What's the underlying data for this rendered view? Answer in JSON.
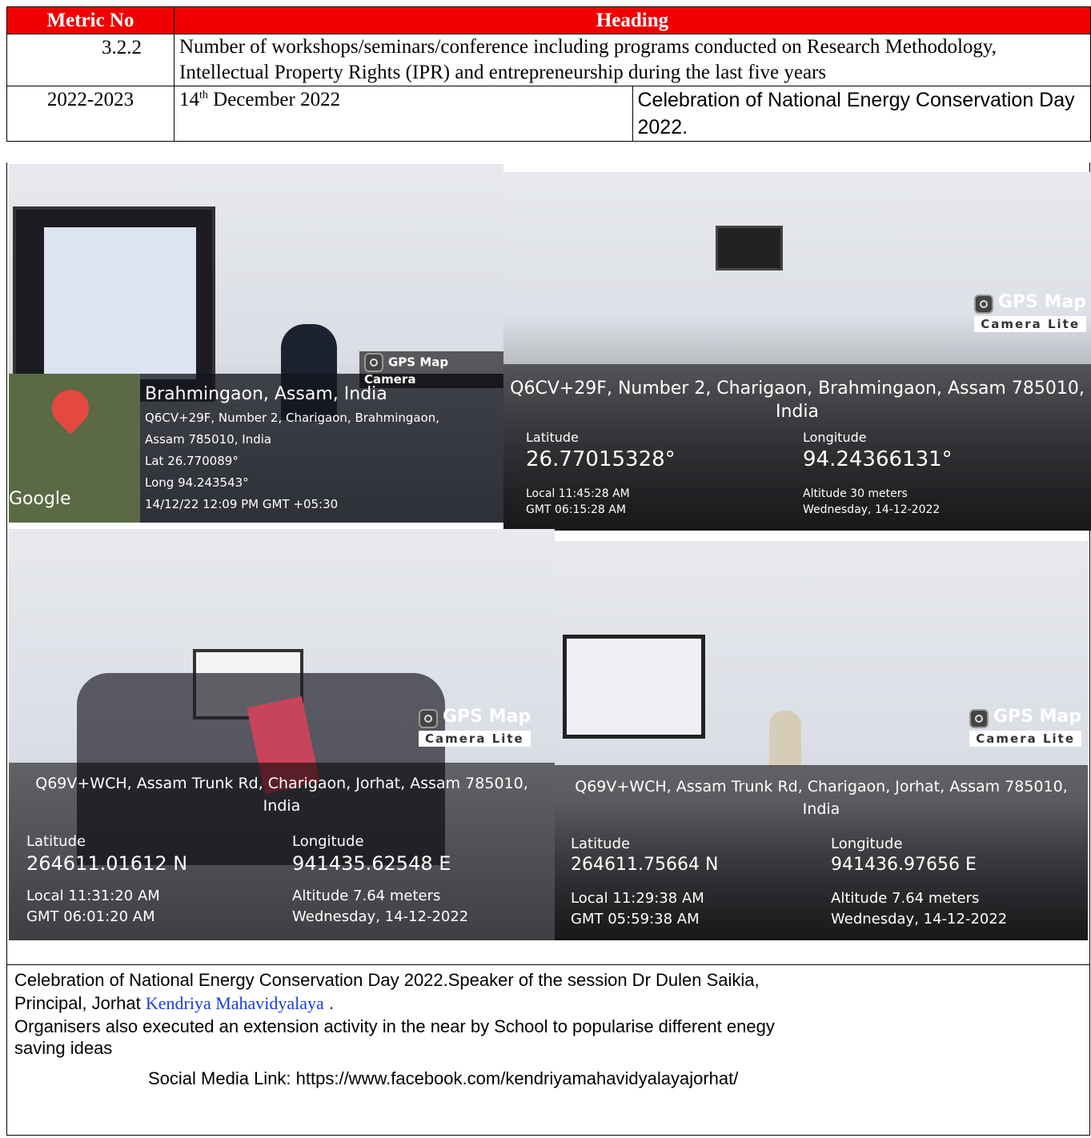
{
  "table": {
    "header": {
      "col1": "Metric No",
      "col2": "Heading"
    },
    "metric": {
      "number": "3.2.2",
      "description": "Number of workshops/seminars/conference including programs conducted on Research Methodology, Intellectual Property Rights (IPR) and entrepreneurship during the last five years"
    },
    "row": {
      "year": "2022-2023",
      "date_day": "14",
      "date_suffix": "th",
      "date_rest": " December 2022",
      "event": "Celebration of National Energy Conservation Day 2022."
    }
  },
  "photos": {
    "p1": {
      "badge": "GPS Map Camera",
      "place": "Brahmingaon, Assam, India",
      "address1": "Q6CV+29F, Number 2, Charigaon, Brahmingaon,",
      "address2": "Assam 785010, India",
      "lat": "Lat 26.770089°",
      "long": "Long 94.243543°",
      "datetime": "14/12/22 12:09 PM GMT +05:30",
      "map_brand": "Google"
    },
    "p2": {
      "badge_top": "GPS Map",
      "badge_bottom": "Camera Lite",
      "address1": "Q6CV+29F, Number 2, Charigaon, Brahmingaon, Assam 785010,",
      "address2": "India",
      "lat_label": "Latitude",
      "lat": "26.77015328°",
      "long_label": "Longitude",
      "long": "94.24366131°",
      "local": "Local 11:45:28 AM",
      "gmt": "GMT 06:15:28 AM",
      "altitude": "Altitude 30 meters",
      "day": "Wednesday, 14-12-2022"
    },
    "p3": {
      "badge_top": "GPS Map",
      "badge_bottom": "Camera Lite",
      "address1": "Q69V+WCH, Assam Trunk Rd, Charigaon, Jorhat, Assam 785010,",
      "address2": "India",
      "lat_label": "Latitude",
      "lat": "264611.01612 N",
      "long_label": "Longitude",
      "long": "941435.62548 E",
      "local": "Local 11:31:20 AM",
      "gmt": "GMT 06:01:20 AM",
      "altitude": "Altitude 7.64 meters",
      "day": "Wednesday, 14-12-2022"
    },
    "p4": {
      "badge_top": "GPS Map",
      "badge_bottom": "Camera Lite",
      "address1": "Q69V+WCH, Assam Trunk Rd, Charigaon, Jorhat, Assam 785010,",
      "address2": "India",
      "lat_label": "Latitude",
      "lat": "264611.75664 N",
      "long_label": "Longitude",
      "long": "941436.97656 E",
      "local": "Local 11:29:38 AM",
      "gmt": "GMT 05:59:38 AM",
      "altitude": "Altitude 7.64 meters",
      "day": "Wednesday, 14-12-2022"
    }
  },
  "caption": {
    "line1": "Celebration of National Energy Conservation Day 2022.Speaker of the session Dr Dulen Saikia,",
    "line2_prefix": "Principal, Jorhat ",
    "line2_link": "Kendriya Mahavidyalaya",
    "line2_suffix": " .",
    "line3": "Organisers also executed an extension activity in the near by School to popularise different enegy",
    "line4": "saving ideas",
    "social": "Social Media Link: https://www.facebook.com/kendriyamahavidyalayajorhat/"
  },
  "colors": {
    "header_bg": "#f00000",
    "header_text": "#ffffff",
    "link": "#1a3ee0"
  }
}
